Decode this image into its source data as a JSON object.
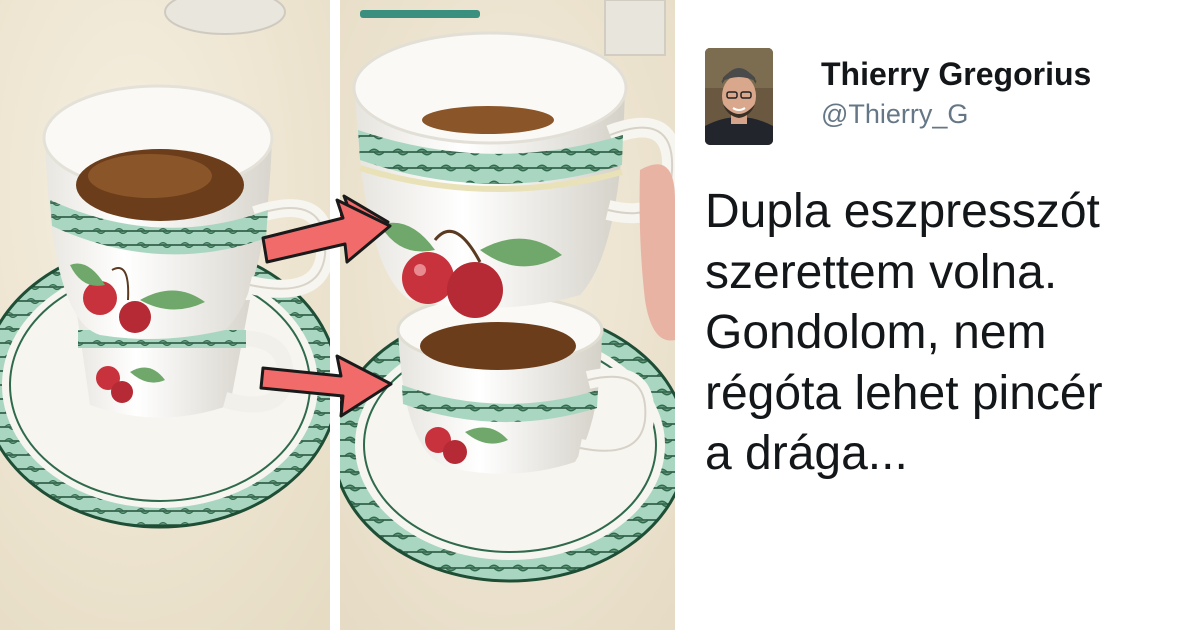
{
  "tweet": {
    "author_name": "Thierry Gregorius",
    "author_handle": "@Thierry_G",
    "text": "Dupla eszpresszót\nszerettem volna.\nGondolom, nem\nrégóta lehet pincér\na drága..."
  },
  "images": {
    "left_photo_icon": "stacked-espresso-cups-photo",
    "right_photo_icon": "stacked-espresso-cups-photo-annotated",
    "arrow_color": "#f26b6b",
    "avatar_icon": "user-avatar-photo"
  },
  "colors": {
    "tablecloth": "#efe6d2",
    "porcelain": "#fbfaf6",
    "pattern_green": "#2f6a4c",
    "pattern_band": "#9fcfb8",
    "coffee": "#6b3d1a",
    "cherry": "#c8323d",
    "text": "#14171a",
    "handle": "#657786"
  }
}
